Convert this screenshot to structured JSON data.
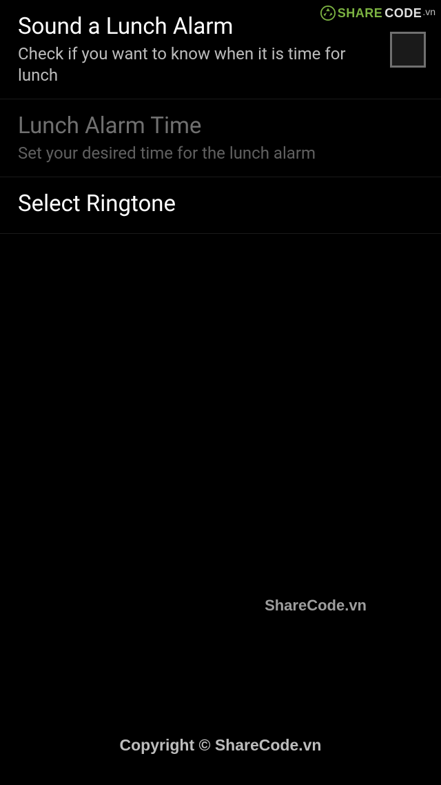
{
  "settings": {
    "sound_alarm": {
      "title": "Sound a Lunch Alarm",
      "subtitle": "Check if you want to know when it is time for lunch",
      "checked": false
    },
    "alarm_time": {
      "title": "Lunch Alarm Time",
      "subtitle": "Set your desired time for the lunch alarm"
    },
    "ringtone": {
      "title": "Select Ringtone"
    }
  },
  "watermark": {
    "logo_share": "SHARE",
    "logo_code": "CODE",
    "logo_vn": ".vn",
    "center_text": "ShareCode.vn",
    "copyright": "Copyright © ShareCode.vn"
  }
}
